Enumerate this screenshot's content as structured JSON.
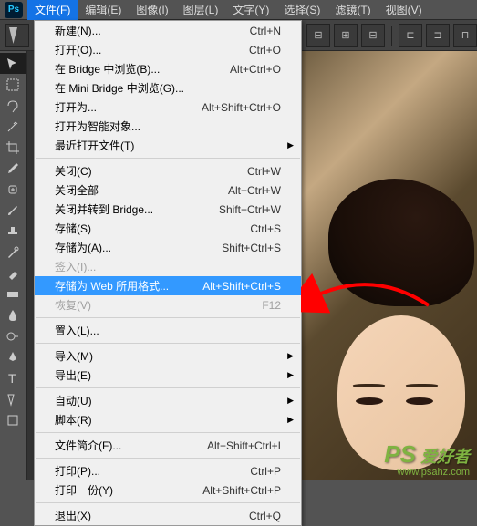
{
  "app_logo": "Ps",
  "menubar": {
    "file": "文件(F)",
    "edit": "编辑(E)",
    "image": "图像(I)",
    "layer": "图层(L)",
    "type": "文字(Y)",
    "select": "选择(S)",
    "filter": "滤镜(T)",
    "view": "视图(V)"
  },
  "dropdown": {
    "new": {
      "label": "新建(N)...",
      "shortcut": "Ctrl+N"
    },
    "open": {
      "label": "打开(O)...",
      "shortcut": "Ctrl+O"
    },
    "browse_bridge": {
      "label": "在 Bridge 中浏览(B)...",
      "shortcut": "Alt+Ctrl+O"
    },
    "browse_minibridge": {
      "label": "在 Mini Bridge 中浏览(G)...",
      "shortcut": ""
    },
    "open_as": {
      "label": "打开为...",
      "shortcut": "Alt+Shift+Ctrl+O"
    },
    "open_smart": {
      "label": "打开为智能对象...",
      "shortcut": ""
    },
    "recent": {
      "label": "最近打开文件(T)",
      "shortcut": ""
    },
    "close": {
      "label": "关闭(C)",
      "shortcut": "Ctrl+W"
    },
    "close_all": {
      "label": "关闭全部",
      "shortcut": "Alt+Ctrl+W"
    },
    "close_bridge": {
      "label": "关闭并转到 Bridge...",
      "shortcut": "Shift+Ctrl+W"
    },
    "save": {
      "label": "存储(S)",
      "shortcut": "Ctrl+S"
    },
    "save_as": {
      "label": "存储为(A)...",
      "shortcut": "Shift+Ctrl+S"
    },
    "checkin": {
      "label": "签入(I)...",
      "shortcut": ""
    },
    "save_web": {
      "label": "存储为 Web 所用格式...",
      "shortcut": "Alt+Shift+Ctrl+S"
    },
    "revert": {
      "label": "恢复(V)",
      "shortcut": "F12"
    },
    "place": {
      "label": "置入(L)...",
      "shortcut": ""
    },
    "import": {
      "label": "导入(M)",
      "shortcut": ""
    },
    "export": {
      "label": "导出(E)",
      "shortcut": ""
    },
    "automate": {
      "label": "自动(U)",
      "shortcut": ""
    },
    "scripts": {
      "label": "脚本(R)",
      "shortcut": ""
    },
    "file_info": {
      "label": "文件简介(F)...",
      "shortcut": "Alt+Shift+Ctrl+I"
    },
    "print": {
      "label": "打印(P)...",
      "shortcut": "Ctrl+P"
    },
    "print_one": {
      "label": "打印一份(Y)",
      "shortcut": "Alt+Shift+Ctrl+P"
    },
    "exit": {
      "label": "退出(X)",
      "shortcut": "Ctrl+Q"
    }
  },
  "watermark": {
    "ps": "PS",
    "text": "爱好者",
    "url": "www.psahz.com"
  }
}
